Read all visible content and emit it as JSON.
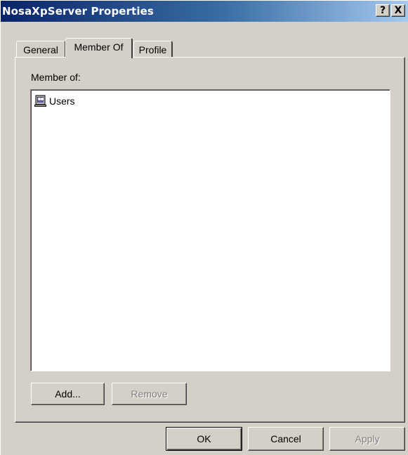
{
  "window": {
    "title": "NosaXpServer Properties",
    "help_button": "?",
    "close_button": "X"
  },
  "tabs": [
    {
      "label": "General",
      "active": false
    },
    {
      "label": "Member Of",
      "active": true
    },
    {
      "label": "Profile",
      "active": false
    }
  ],
  "member_of": {
    "label": "Member of:",
    "items": [
      {
        "name": "Users",
        "icon": "group-icon"
      }
    ],
    "add_label": "Add...",
    "remove_label": "Remove"
  },
  "footer": {
    "ok_label": "OK",
    "cancel_label": "Cancel",
    "apply_label": "Apply"
  }
}
